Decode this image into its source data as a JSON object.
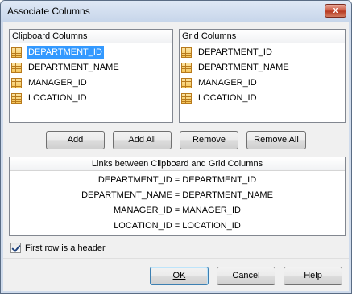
{
  "window": {
    "title": "Associate Columns",
    "close_label": "x"
  },
  "clipboard": {
    "header": "Clipboard Columns",
    "items": [
      "DEPARTMENT_ID",
      "DEPARTMENT_NAME",
      "MANAGER_ID",
      "LOCATION_ID"
    ],
    "selected_index": 0
  },
  "grid": {
    "header": "Grid Columns",
    "items": [
      "DEPARTMENT_ID",
      "DEPARTMENT_NAME",
      "MANAGER_ID",
      "LOCATION_ID"
    ]
  },
  "actions": {
    "add": "Add",
    "add_all": "Add All",
    "remove": "Remove",
    "remove_all": "Remove All"
  },
  "links": {
    "header": "Links between Clipboard and Grid Columns",
    "rows": [
      "DEPARTMENT_ID = DEPARTMENT_ID",
      "DEPARTMENT_NAME = DEPARTMENT_NAME",
      "MANAGER_ID = MANAGER_ID",
      "LOCATION_ID = LOCATION_ID"
    ]
  },
  "options": {
    "first_row_header_label": "First row is a header",
    "first_row_header_checked": true
  },
  "footer": {
    "ok": "OK",
    "cancel": "Cancel",
    "help": "Help"
  }
}
